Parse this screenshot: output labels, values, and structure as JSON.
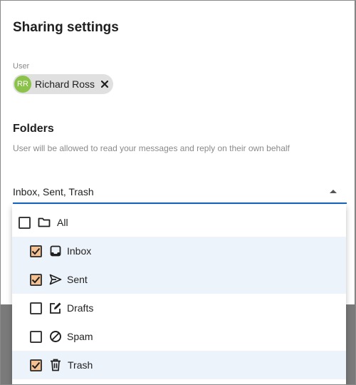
{
  "dialog": {
    "title": "Sharing settings",
    "user_label": "User",
    "user_chip": {
      "initials": "RR",
      "name": "Richard Ross",
      "avatar_color": "#8bc34a"
    },
    "folders_title": "Folders",
    "folders_helper": "User will be allowed to read your messages and reply on their own behalf",
    "select_value": "Inbox, Sent, Trash"
  },
  "options": [
    {
      "label": "All",
      "icon": "folder-icon",
      "checked": false
    },
    {
      "label": "Inbox",
      "icon": "inbox-icon",
      "checked": true
    },
    {
      "label": "Sent",
      "icon": "send-icon",
      "checked": true
    },
    {
      "label": "Drafts",
      "icon": "edit-icon",
      "checked": false
    },
    {
      "label": "Spam",
      "icon": "block-icon",
      "checked": false
    },
    {
      "label": "Trash",
      "icon": "trash-icon",
      "checked": true
    }
  ],
  "colors": {
    "accent": "#1565c0",
    "check_fill": "#f6c190",
    "selected_row": "#edf3fb"
  }
}
